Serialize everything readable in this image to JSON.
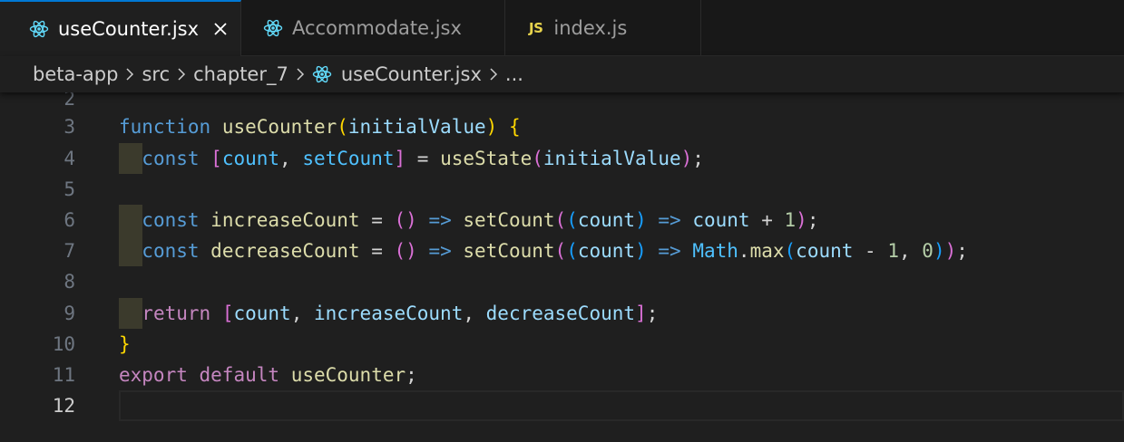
{
  "tabs": [
    {
      "label": "useCounter.jsx",
      "icon": "react-icon",
      "active": true
    },
    {
      "label": "Accommodate.jsx",
      "icon": "react-icon",
      "active": false
    },
    {
      "label": "index.js",
      "icon": "js-icon",
      "icon_text": "JS",
      "active": false
    }
  ],
  "breadcrumb": {
    "segments": [
      "beta-app",
      "src",
      "chapter_7",
      "useCounter.jsx",
      "..."
    ]
  },
  "editor": {
    "line_numbers": [
      "2",
      "3",
      "4",
      "5",
      "6",
      "7",
      "8",
      "9",
      "10",
      "11",
      "12"
    ],
    "current_line": "12",
    "lines": [
      "",
      "function useCounter(initialValue) {",
      "  const [count, setCount] = useState(initialValue);",
      "",
      "  const increaseCount = () => setCount((count) => count + 1);",
      "  const decreaseCount = () => setCount((count) => Math.max(count - 1, 0));",
      "",
      "  return [count, increaseCount, decreaseCount];",
      "}",
      "export default useCounter;",
      ""
    ]
  },
  "colors": {
    "tab_active_border": "#0078d4",
    "keyword": "#569cd6",
    "control_keyword": "#c586c0",
    "function": "#dcdcaa",
    "variable": "#9cdcfe",
    "number": "#b5cea8",
    "bracket_level1": "#ffd700",
    "bracket_level2": "#da70d6",
    "bracket_level3": "#179fff"
  }
}
